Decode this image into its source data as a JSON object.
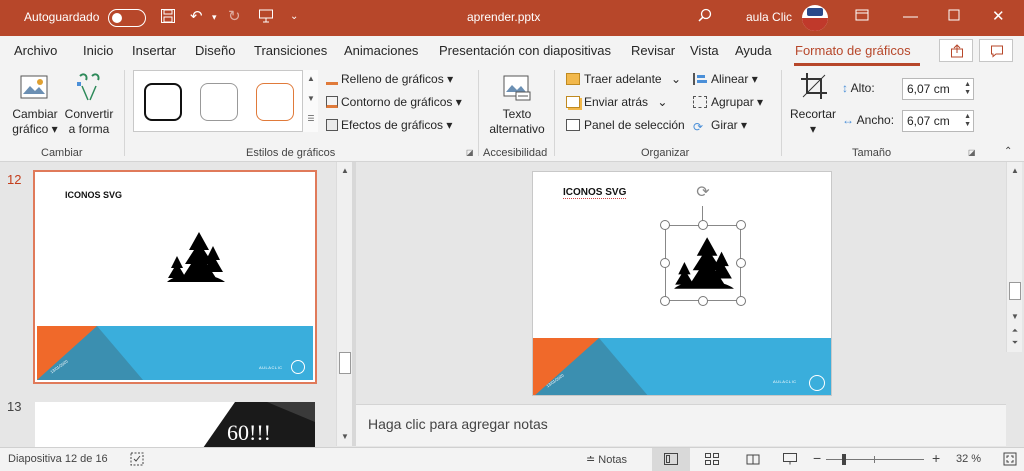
{
  "titlebar": {
    "autosave_label": "Autoguardado",
    "file_name": "aprender.pptx",
    "user_name": "aula Clic",
    "brand_color": "#b7472a"
  },
  "menu": {
    "tabs": [
      "Archivo",
      "Inicio",
      "Insertar",
      "Diseño",
      "Transiciones",
      "Animaciones",
      "Presentación con diapositivas",
      "Revisar",
      "Vista",
      "Ayuda",
      "Formato de gráficos"
    ],
    "active_tab": "Formato de gráficos"
  },
  "ribbon": {
    "cambiar": {
      "change_graphic_line1": "Cambiar",
      "change_graphic_line2": "gráfico",
      "convert_line1": "Convertir",
      "convert_line2": "a forma",
      "group_label": "Cambiar"
    },
    "estilos": {
      "fill": "Relleno de gráficos",
      "outline": "Contorno de gráficos",
      "effects": "Efectos de gráficos",
      "group_label": "Estilos de gráficos"
    },
    "accesibilidad": {
      "alt_text_line1": "Texto",
      "alt_text_line2": "alternativo",
      "group_label": "Accesibilidad"
    },
    "organizar": {
      "bring_forward": "Traer adelante",
      "send_backward": "Enviar atrás",
      "selection_pane": "Panel de selección",
      "align": "Alinear",
      "group": "Agrupar",
      "rotate": "Girar",
      "group_label": "Organizar"
    },
    "tamano": {
      "crop": "Recortar",
      "height_label": "Alto:",
      "height_value": "6,07 cm",
      "width_label": "Ancho:",
      "width_value": "6,07 cm",
      "group_label": "Tamaño"
    }
  },
  "thumbnails": {
    "items": [
      {
        "number": "12",
        "title": "ICONOS SVG",
        "footer_left": "13/01/2020",
        "footer_right": "AULACLIC",
        "selected": true
      },
      {
        "number": "13",
        "overlay_text": "60!!!",
        "selected": false
      }
    ]
  },
  "main_slide": {
    "title": "ICONOS SVG",
    "footer_left": "13/01/2020",
    "footer_right": "AULACLIC",
    "accent_orange": "#f0692a",
    "accent_blue": "#3aaedc"
  },
  "notes": {
    "placeholder": "Haga clic para agregar notas"
  },
  "statusbar": {
    "slide_info": "Diapositiva 12 de 16",
    "notes_label": "Notas",
    "zoom": "32 %"
  }
}
